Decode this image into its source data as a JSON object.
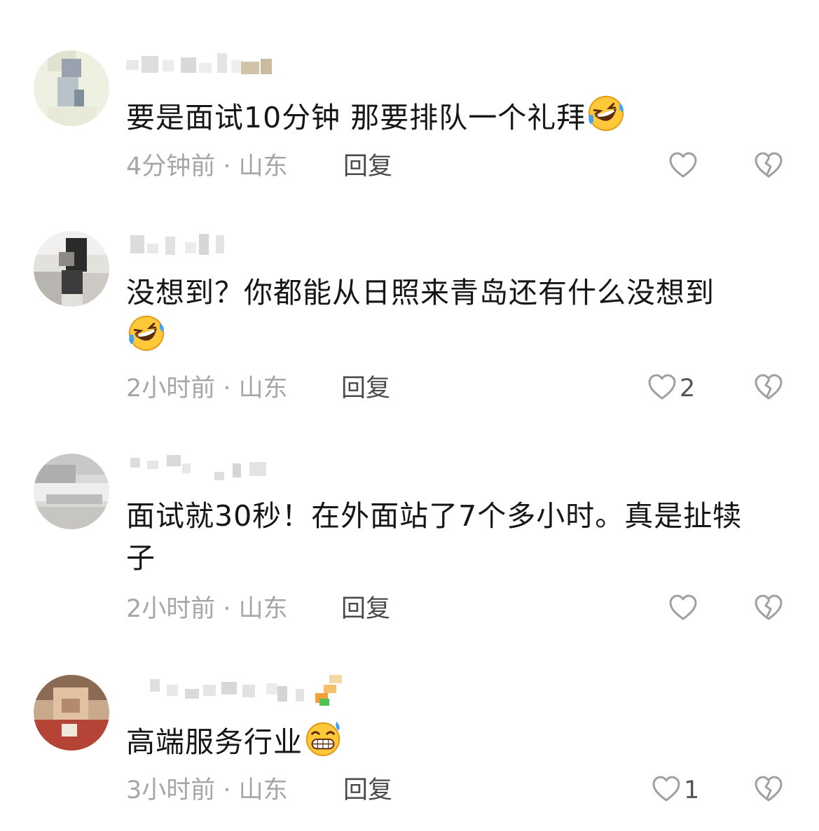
{
  "comments": [
    {
      "content": "要是面试10分钟 那要排队一个礼拜",
      "emoji": "rofl-emoji",
      "time_location": "4分钟前 · 山东",
      "reply_label": "回复",
      "likes": ""
    },
    {
      "content": "没想到？你都能从日照来青岛还有什么没想到",
      "emoji": "rofl-emoji",
      "time_location": "2小时前 · 山东",
      "reply_label": "回复",
      "likes": "2"
    },
    {
      "content": "面试就30秒！在外面站了7个多小时。真是扯犊子",
      "emoji": "",
      "time_location": "2小时前 · 山东",
      "reply_label": "回复",
      "likes": ""
    },
    {
      "content": "高端服务行业",
      "emoji": "grinning-sweat-emoji",
      "time_location": "3小时前 · 山东",
      "reply_label": "回复",
      "likes": "1"
    }
  ],
  "icons": {
    "like": "heart-outline-icon",
    "dislike": "broken-heart-icon"
  },
  "colors": {
    "text": "#161616",
    "meta": "#a6a6a6",
    "reply": "#4a4a4a",
    "icon": "#a0a0a0"
  }
}
